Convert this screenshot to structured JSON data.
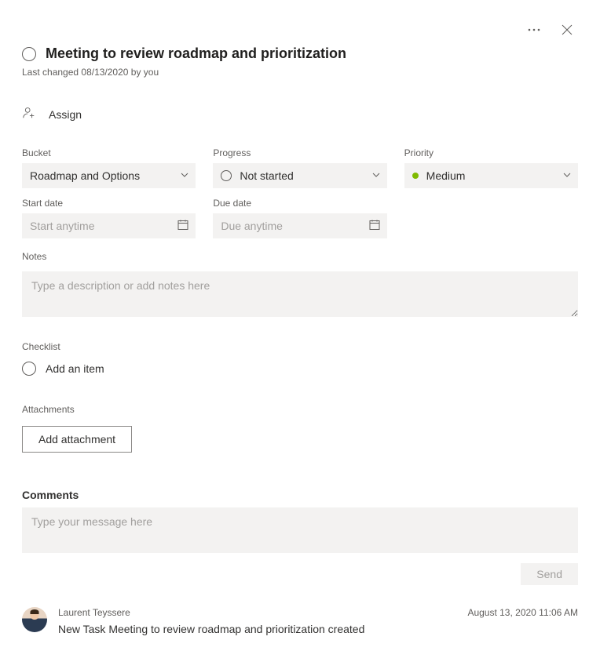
{
  "header": {
    "title": "Meeting to review roadmap and prioritization",
    "last_changed": "Last changed 08/13/2020 by you"
  },
  "assign": {
    "label": "Assign"
  },
  "fields": {
    "bucket": {
      "label": "Bucket",
      "value": "Roadmap and Options"
    },
    "progress": {
      "label": "Progress",
      "value": "Not started"
    },
    "priority": {
      "label": "Priority",
      "value": "Medium"
    },
    "start_date": {
      "label": "Start date",
      "placeholder": "Start anytime"
    },
    "due_date": {
      "label": "Due date",
      "placeholder": "Due anytime"
    }
  },
  "notes": {
    "label": "Notes",
    "placeholder": "Type a description or add notes here"
  },
  "checklist": {
    "label": "Checklist",
    "add_item": "Add an item"
  },
  "attachments": {
    "label": "Attachments",
    "button": "Add attachment"
  },
  "comments": {
    "heading": "Comments",
    "placeholder": "Type your message here",
    "send": "Send",
    "entries": [
      {
        "author": "Laurent Teyssere",
        "timestamp": "August 13, 2020 11:06 AM",
        "text": "New Task Meeting to review roadmap and prioritization created"
      }
    ]
  }
}
